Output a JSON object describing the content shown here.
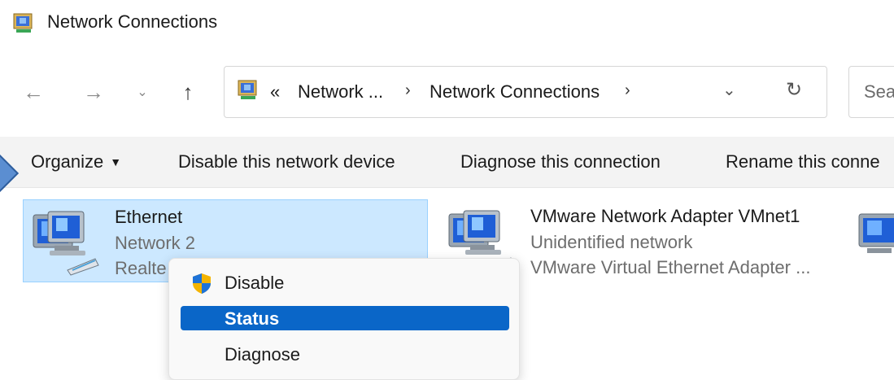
{
  "window": {
    "title": "Network Connections"
  },
  "nav": {
    "back_icon": "arrow-left-icon",
    "forward_icon": "arrow-right-icon",
    "recent_icon": "chevron-down-icon",
    "up_icon": "arrow-up-icon"
  },
  "address": {
    "overflow": "«",
    "crumbs": [
      "Network ...",
      "Network Connections"
    ],
    "separator": "›",
    "dropdown_icon": "chevron-down-icon",
    "refresh_icon": "refresh-icon"
  },
  "search": {
    "placeholder": "Sea"
  },
  "commands": {
    "organize": "Organize",
    "disable": "Disable this network device",
    "diagnose": "Diagnose this connection",
    "rename": "Rename this conne"
  },
  "connections": [
    {
      "name": "Ethernet",
      "network": "Network 2",
      "device": "Realte",
      "selected": true
    },
    {
      "name": "VMware Network Adapter VMnet1",
      "network": "Unidentified network",
      "device": "VMware Virtual Ethernet Adapter ...",
      "selected": false
    }
  ],
  "context_menu": {
    "items": [
      {
        "label": "Disable",
        "icon": "uac-shield-icon"
      },
      {
        "label": "Status",
        "active": true
      },
      {
        "label": "Diagnose"
      }
    ]
  },
  "colors": {
    "selection_bg": "#cce8ff",
    "menu_highlight": "#0a66c8",
    "command_bar_bg": "#f3f3f3"
  }
}
